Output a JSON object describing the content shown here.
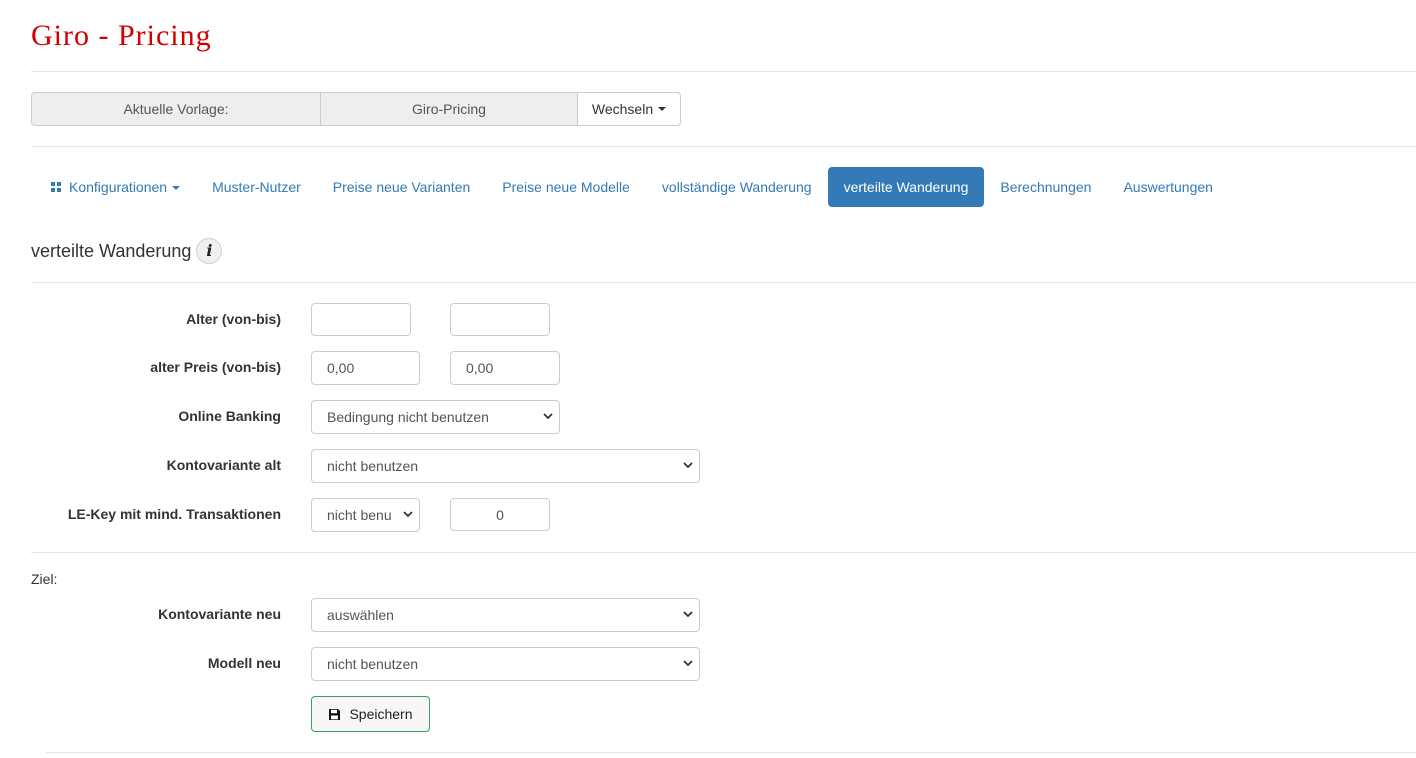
{
  "app": {
    "title": "Giro - Pricing"
  },
  "template_bar": {
    "label": "Aktuelle Vorlage:",
    "value": "Giro-Pricing",
    "switch_label": "Wechseln"
  },
  "nav": {
    "items": [
      {
        "label": "Konfigurationen",
        "icon": "grid-icon",
        "dropdown": true
      },
      {
        "label": "Muster-Nutzer"
      },
      {
        "label": "Preise neue Varianten"
      },
      {
        "label": "Preise neue Modelle"
      },
      {
        "label": "vollständige Wanderung"
      },
      {
        "label": "verteilte Wanderung",
        "active": true
      },
      {
        "label": "Berechnungen"
      },
      {
        "label": "Auswertungen"
      }
    ]
  },
  "section": {
    "title": "verteilte Wanderung",
    "info_icon_glyph": "i"
  },
  "form": {
    "age": {
      "label": "Alter (von-bis)",
      "from": "",
      "to": ""
    },
    "old_price": {
      "label": "alter Preis (von-bis)",
      "from": "0,00",
      "to": "0,00"
    },
    "online_banking": {
      "label": "Online Banking",
      "selected": "Bedingung nicht benutzen"
    },
    "account_variant_old": {
      "label": "Kontovariante alt",
      "selected": "nicht benutzen"
    },
    "le_key": {
      "label": "LE-Key mit mind. Transaktionen",
      "selected": "nicht benu",
      "value": "0"
    }
  },
  "target": {
    "heading": "Ziel:",
    "account_variant_new": {
      "label": "Kontovariante neu",
      "selected": "auswählen"
    },
    "model_new": {
      "label": "Modell neu",
      "selected": "nicht benutzen"
    },
    "save_label": "Speichern"
  },
  "colors": {
    "title": "#d40000",
    "link": "#337ab7",
    "active_tab": "#337ab7",
    "save_border": "#3aa062"
  }
}
